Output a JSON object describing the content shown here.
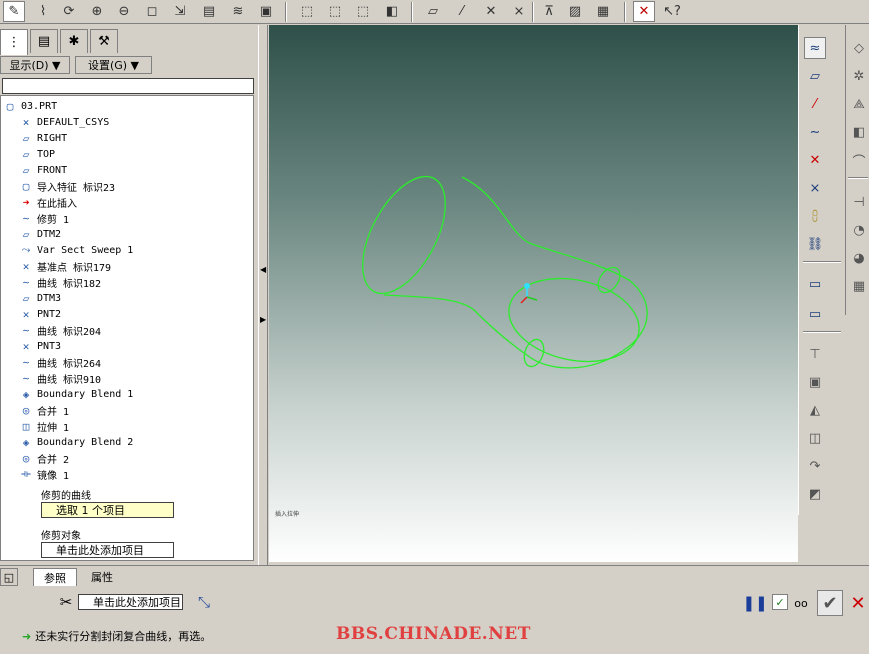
{
  "toolbar": {
    "icons": [
      "sketch-icon",
      "datum-axis-icon",
      "spin-icon",
      "zoom-in-icon",
      "zoom-out-icon",
      "zoom-fit-icon",
      "orient-icon",
      "saved-view-icon",
      "layer-icon",
      "view-manager-icon",
      "wireframe-icon",
      "hidden-line-icon",
      "no-hidden-icon",
      "shading-icon",
      "datum-plane-display-icon",
      "datum-axis-display-icon",
      "datum-point-display-icon",
      "csys-display-icon",
      "annotation-icon",
      "sketch-toggle-icon",
      "save-icon",
      "close-window-icon",
      "context-help-icon"
    ]
  },
  "left_panel": {
    "show_label": "显示(D) ▼",
    "settings_label": "设置(G) ▼",
    "tree": [
      {
        "label": "03.PRT",
        "icon": "part-icon"
      },
      {
        "label": "DEFAULT_CSYS",
        "icon": "csys-icon"
      },
      {
        "label": "RIGHT",
        "icon": "datum-plane-icon"
      },
      {
        "label": "TOP",
        "icon": "datum-plane-icon"
      },
      {
        "label": "FRONT",
        "icon": "datum-plane-icon"
      },
      {
        "label": "导入特征 标识23",
        "icon": "import-icon"
      },
      {
        "label": "在此插入",
        "icon": "insert-arrow-icon"
      },
      {
        "label": "修剪 1",
        "icon": "curve-icon"
      },
      {
        "label": "DTM2",
        "icon": "datum-plane-icon"
      },
      {
        "label": "Var Sect Sweep 1",
        "icon": "sweep-icon"
      },
      {
        "label": "基准点 标识179",
        "icon": "datum-point-icon"
      },
      {
        "label": "曲线 标识182",
        "icon": "curve-icon"
      },
      {
        "label": "DTM3",
        "icon": "datum-plane-icon"
      },
      {
        "label": "PNT2",
        "icon": "datum-point-icon"
      },
      {
        "label": "曲线 标识204",
        "icon": "curve-icon"
      },
      {
        "label": "PNT3",
        "icon": "datum-point-icon"
      },
      {
        "label": "曲线 标识264",
        "icon": "curve-icon"
      },
      {
        "label": "曲线 标识910",
        "icon": "curve-icon"
      },
      {
        "label": "Boundary Blend 1",
        "icon": "boundary-blend-icon"
      },
      {
        "label": "合并 1",
        "icon": "merge-icon"
      },
      {
        "label": "拉伸 1",
        "icon": "extrude-icon"
      },
      {
        "label": "Boundary Blend 2",
        "icon": "boundary-blend-icon"
      },
      {
        "label": "合并 2",
        "icon": "merge-icon"
      },
      {
        "label": "镜像 1",
        "icon": "mirror-icon"
      }
    ],
    "trim_curve_label": "修剪的曲线",
    "trim_curve_value": "选取 1 个项目",
    "trim_object_label": "修剪对象",
    "trim_object_value": "单击此处添加项目"
  },
  "graphics": {
    "insert_tag": "插入拉伸"
  },
  "right_toolbar": {
    "icons": [
      "datum-plane-tool-icon",
      "datum-plane-tool-icon",
      "datum-axis-tool-icon",
      "datum-curve-tool-icon",
      "datum-point-tool-icon",
      "csys-tool-icon",
      "analysis-icon",
      "ref-link-icon",
      "datum-plane-add-icon",
      "datum-plane-edit-icon",
      "round-icon",
      "shell-icon",
      "draft-icon",
      "rib-icon",
      "blend-icon",
      "sweep-tool-icon"
    ],
    "icons2": [
      "hole-icon",
      "revolve-icon",
      "loft-icon",
      "curve-feature-icon",
      "pattern-icon",
      "mirror-tool-icon",
      "trim-tool-icon",
      "merge-tool-icon",
      "table-icon"
    ]
  },
  "dashboard": {
    "tab_refs": "参照",
    "tab_props": "属性",
    "trim_field": "单击此处添加项目",
    "message": "还未实行分割封闭复合曲线，再选。",
    "watermark": "BBS.CHINADE.NET",
    "accent": "#2aa52a"
  }
}
